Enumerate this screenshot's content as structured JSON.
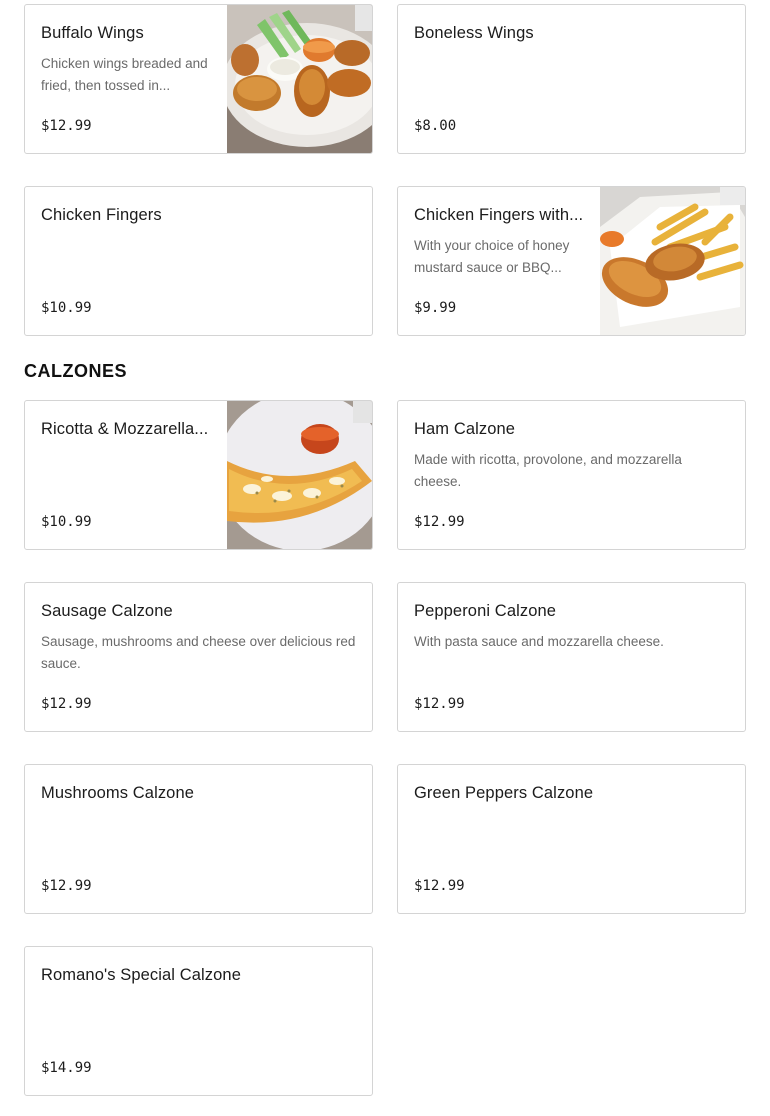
{
  "items_top": [
    {
      "name": "Buffalo Wings",
      "desc": "Chicken wings breaded and fried, then tossed in...",
      "price": "$12.99",
      "photo": "buffalo-wings-photo"
    },
    {
      "name": "Boneless Wings",
      "desc": "",
      "price": "$8.00"
    },
    {
      "name": "Chicken Fingers",
      "desc": "",
      "price": "$10.99"
    },
    {
      "name": "Chicken Fingers with...",
      "desc": "With your choice of honey mustard sauce or BBQ...",
      "price": "$9.99",
      "photo": "chicken-fingers-fries-photo"
    }
  ],
  "calzones": {
    "title": "CALZONES",
    "items": [
      {
        "name": "Ricotta & Mozzarella...",
        "desc": "",
        "price": "$10.99",
        "photo": "calzone-photo"
      },
      {
        "name": "Ham Calzone",
        "desc": "Made with ricotta, provolone, and mozzarella cheese.",
        "price": "$12.99"
      },
      {
        "name": "Sausage Calzone",
        "desc": "Sausage, mushrooms and cheese over delicious red sauce.",
        "price": "$12.99"
      },
      {
        "name": "Pepperoni Calzone",
        "desc": "With pasta sauce and mozzarella cheese.",
        "price": "$12.99"
      },
      {
        "name": "Mushrooms Calzone",
        "desc": "",
        "price": "$12.99"
      },
      {
        "name": "Green Peppers Calzone",
        "desc": "",
        "price": "$12.99"
      },
      {
        "name": "Romano's Special Calzone",
        "desc": "",
        "price": "$14.99"
      }
    ]
  }
}
